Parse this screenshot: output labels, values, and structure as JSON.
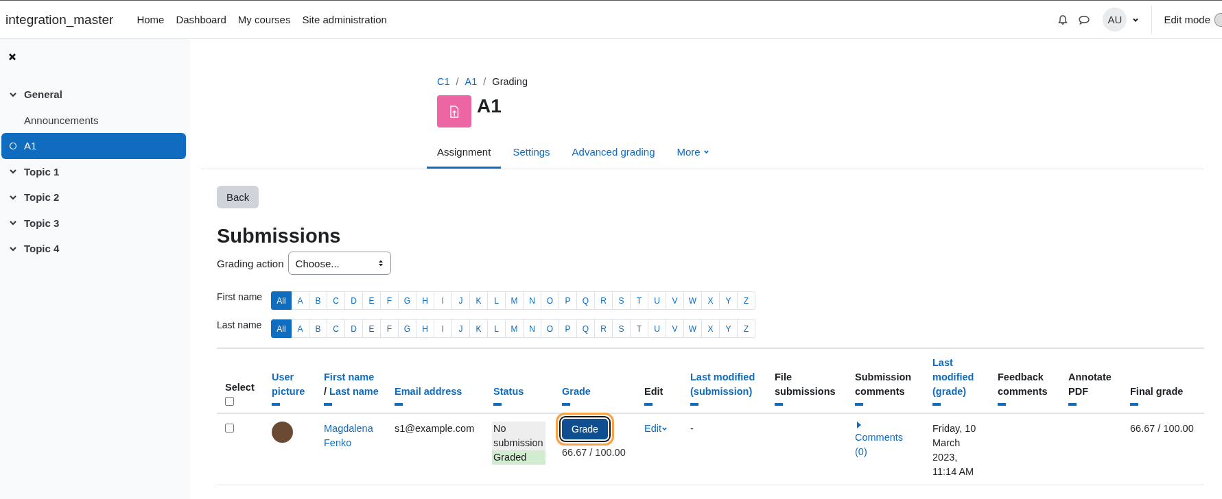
{
  "topbar": {
    "brand": "integration_master",
    "nav": [
      "Home",
      "Dashboard",
      "My courses",
      "Site administration"
    ],
    "avatar": "AU",
    "edit_mode": "Edit mode"
  },
  "sidebar": {
    "items": [
      {
        "label": "General",
        "kind": "section",
        "expanded": true,
        "selected": false,
        "children": [
          {
            "label": "Announcements",
            "kind": "activity",
            "selected": false
          },
          {
            "label": "A1",
            "kind": "activity",
            "selected": true
          }
        ]
      },
      {
        "label": "Topic 1",
        "kind": "section",
        "expanded": true,
        "selected": false
      },
      {
        "label": "Topic 2",
        "kind": "section",
        "expanded": true,
        "selected": false
      },
      {
        "label": "Topic 3",
        "kind": "section",
        "expanded": true,
        "selected": false
      },
      {
        "label": "Topic 4",
        "kind": "section",
        "expanded": true,
        "selected": false
      }
    ]
  },
  "breadcrumb": [
    {
      "kind": "link",
      "label": "C1"
    },
    {
      "kind": "separator",
      "label": "/"
    },
    {
      "kind": "link",
      "label": "A1"
    },
    {
      "kind": "separator",
      "label": "/"
    },
    {
      "kind": "current",
      "label": "Grading"
    }
  ],
  "page_title": "A1",
  "tabs": [
    {
      "label": "Assignment",
      "selected": true,
      "dropdown": false
    },
    {
      "label": "Settings",
      "selected": false,
      "dropdown": false
    },
    {
      "label": "Advanced grading",
      "selected": false,
      "dropdown": false
    },
    {
      "label": "More",
      "selected": false,
      "dropdown": true
    }
  ],
  "back_button": "Back",
  "heading": "Submissions",
  "grading_action": {
    "label": "Grading action",
    "value": "Choose..."
  },
  "initials_bars": [
    {
      "label": "First name",
      "letters": [
        {
          "label": "All",
          "selected": true
        },
        {
          "label": "A",
          "selected": false
        },
        {
          "label": "B",
          "selected": false
        },
        {
          "label": "C",
          "selected": false
        },
        {
          "label": "D",
          "selected": false
        },
        {
          "label": "E",
          "selected": false
        },
        {
          "label": "F",
          "selected": false
        },
        {
          "label": "G",
          "selected": false
        },
        {
          "label": "H",
          "selected": false
        },
        {
          "label": "I",
          "selected": false
        },
        {
          "label": "J",
          "selected": false
        },
        {
          "label": "K",
          "selected": false
        },
        {
          "label": "L",
          "selected": false
        },
        {
          "label": "M",
          "selected": false
        },
        {
          "label": "N",
          "selected": false
        },
        {
          "label": "O",
          "selected": false
        },
        {
          "label": "P",
          "selected": false
        },
        {
          "label": "Q",
          "selected": false
        },
        {
          "label": "R",
          "selected": false
        },
        {
          "label": "S",
          "selected": false
        },
        {
          "label": "T",
          "selected": false
        },
        {
          "label": "U",
          "selected": false
        },
        {
          "label": "V",
          "selected": false
        },
        {
          "label": "W",
          "selected": false
        },
        {
          "label": "X",
          "selected": false
        },
        {
          "label": "Y",
          "selected": false
        },
        {
          "label": "Z",
          "selected": false
        }
      ]
    },
    {
      "label": "Last name",
      "letters": [
        {
          "label": "All",
          "selected": true
        },
        {
          "label": "A",
          "selected": false
        },
        {
          "label": "B",
          "selected": false
        },
        {
          "label": "C",
          "selected": false
        },
        {
          "label": "D",
          "selected": false
        },
        {
          "label": "E",
          "selected": false
        },
        {
          "label": "F",
          "selected": false
        },
        {
          "label": "G",
          "selected": false
        },
        {
          "label": "H",
          "selected": false
        },
        {
          "label": "I",
          "selected": false
        },
        {
          "label": "J",
          "selected": false
        },
        {
          "label": "K",
          "selected": false
        },
        {
          "label": "L",
          "selected": false
        },
        {
          "label": "M",
          "selected": false
        },
        {
          "label": "N",
          "selected": false
        },
        {
          "label": "O",
          "selected": false
        },
        {
          "label": "P",
          "selected": false
        },
        {
          "label": "Q",
          "selected": false
        },
        {
          "label": "R",
          "selected": false
        },
        {
          "label": "S",
          "selected": false
        },
        {
          "label": "T",
          "selected": false
        },
        {
          "label": "U",
          "selected": false
        },
        {
          "label": "V",
          "selected": false
        },
        {
          "label": "W",
          "selected": false
        },
        {
          "label": "X",
          "selected": false
        },
        {
          "label": "Y",
          "selected": false
        },
        {
          "label": "Z",
          "selected": false
        }
      ]
    }
  ],
  "table": {
    "columns": [
      {
        "kind": "select",
        "label": "Select",
        "checked": false
      },
      {
        "kind": "sortable",
        "label": "User picture"
      },
      {
        "kind": "name-pair",
        "first": "First name",
        "separator": "/",
        "last": "Last name"
      },
      {
        "kind": "sortable",
        "label": "Email address"
      },
      {
        "kind": "sortable",
        "label": "Status"
      },
      {
        "kind": "sortable",
        "label": "Grade"
      },
      {
        "kind": "plain",
        "label": "Edit"
      },
      {
        "kind": "sortable",
        "label": "Last modified (submission)"
      },
      {
        "kind": "plain",
        "label": "File submissions"
      },
      {
        "kind": "plain",
        "label": "Submission comments"
      },
      {
        "kind": "sortable",
        "label": "Last modified (grade)"
      },
      {
        "kind": "plain",
        "label": "Feedback comments"
      },
      {
        "kind": "plain",
        "label": "Annotate PDF"
      },
      {
        "kind": "plain",
        "label": "Final grade"
      }
    ],
    "rows": [
      {
        "checked": false,
        "name": "Magdalena Fenko",
        "email": "s1@example.com",
        "status": [
          {
            "label": "No submission",
            "color": "#eeeeee"
          },
          {
            "label": "Graded",
            "color": "#d2eccf"
          }
        ],
        "grade_button": {
          "label": "Grade",
          "focused": true
        },
        "grade": "66.67 / 100.00",
        "edit": "Edit",
        "last_modified_submission": "-",
        "comments": "Comments (0)",
        "last_modified_grade": "Friday, 10 March 2023, 11:14 AM",
        "final_grade": "66.67 / 100.00"
      }
    ]
  }
}
